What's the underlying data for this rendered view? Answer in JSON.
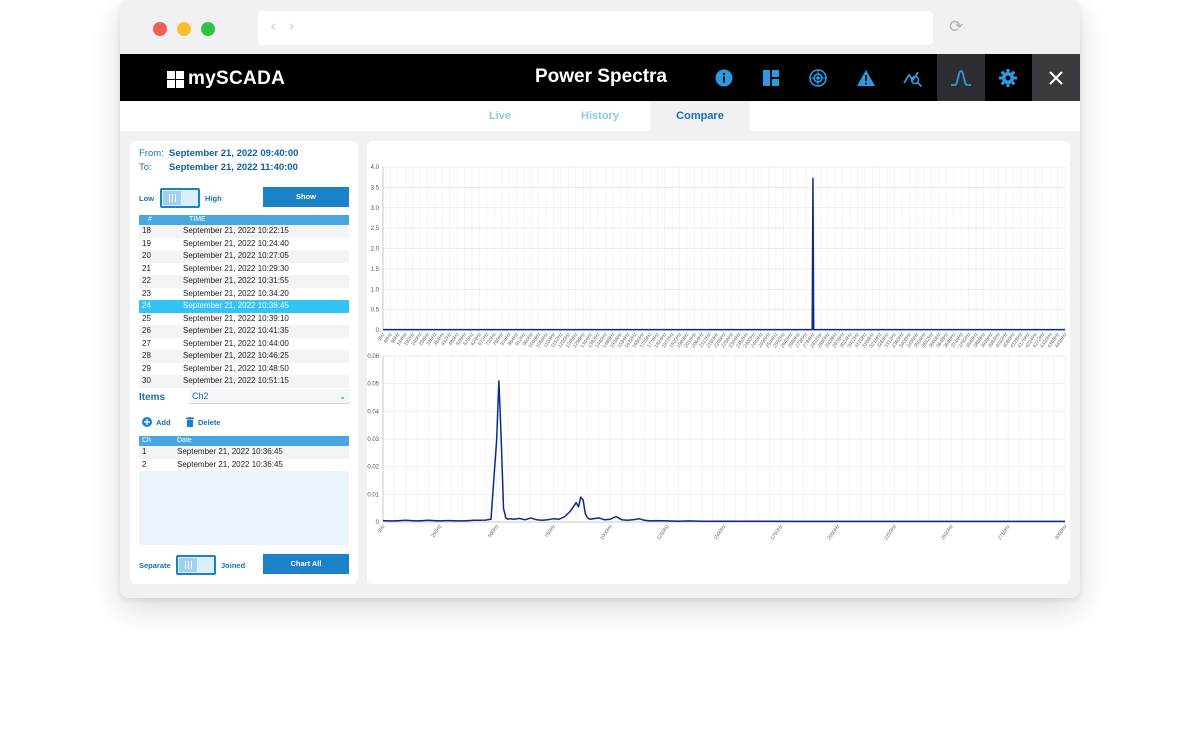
{
  "app": {
    "logo_text": "mySCADA",
    "title": "Power Spectra",
    "header_icons": [
      "info-icon",
      "dashboard-icon",
      "network-icon",
      "alarm-icon",
      "trend-icon",
      "spectrum-icon",
      "settings-icon",
      "close-icon"
    ]
  },
  "tabs": [
    {
      "label": "Live",
      "active": false
    },
    {
      "label": "History",
      "active": false
    },
    {
      "label": "Compare",
      "active": true
    }
  ],
  "range": {
    "from_label": "From:",
    "from_value": "September 21, 2022 09:40:00",
    "to_label": "To:",
    "to_value": "September 21, 2022 11:40:00"
  },
  "quality": {
    "low_label": "Low",
    "high_label": "High",
    "show_label": "Show"
  },
  "time_table": {
    "headers": [
      "#",
      "TIME"
    ],
    "rows": [
      {
        "n": "18",
        "time": "September 21, 2022 10:22:15"
      },
      {
        "n": "19",
        "time": "September 21, 2022 10:24:40"
      },
      {
        "n": "20",
        "time": "September 21, 2022 10:27:05"
      },
      {
        "n": "21",
        "time": "September 21, 2022 10:29:30"
      },
      {
        "n": "22",
        "time": "September 21, 2022 10:31:55"
      },
      {
        "n": "23",
        "time": "September 21, 2022 10:34:20"
      },
      {
        "n": "24",
        "time": "September 21, 2022 10:36:45",
        "selected": true
      },
      {
        "n": "25",
        "time": "September 21, 2022 10:39:10"
      },
      {
        "n": "26",
        "time": "September 21, 2022 10:41:35"
      },
      {
        "n": "27",
        "time": "September 21, 2022 10:44:00"
      },
      {
        "n": "28",
        "time": "September 21, 2022 10:46:25"
      },
      {
        "n": "29",
        "time": "September 21, 2022 10:48:50"
      },
      {
        "n": "30",
        "time": "September 21, 2022 10:51:15"
      }
    ]
  },
  "items": {
    "label": "Items",
    "selected": "Ch2",
    "add_label": "Add",
    "delete_label": "Delete"
  },
  "items_table": {
    "headers": [
      "Ch",
      "Date"
    ],
    "rows": [
      {
        "ch": "1",
        "date": "September 21, 2022 10:36:45"
      },
      {
        "ch": "2",
        "date": "September 21, 2022 10:36:45"
      }
    ]
  },
  "footer": {
    "separate_label": "Separate",
    "joined_label": "Joined",
    "chart_all_label": "Chart All"
  },
  "colors": {
    "accent": "#1b82c9",
    "selected_row": "#33c3f5",
    "series": "#0b2a8a",
    "header_bg": "#000000"
  },
  "chart_data": [
    {
      "type": "line",
      "ylim": [
        0,
        4.0
      ],
      "yticks": [
        "0",
        "0.5",
        "1.0",
        "1.5",
        "2.0",
        "2.5",
        "3.0",
        "3.5",
        "4.0"
      ],
      "x_start": 0,
      "x_step": 48,
      "x_count": 93,
      "x_unit": "Hz",
      "x_tick_every": 1,
      "grid": true,
      "peaks": [
        {
          "x": 2784,
          "y": 3.72
        }
      ],
      "baseline": 0.01
    },
    {
      "type": "line",
      "ylim": [
        0,
        0.06
      ],
      "yticks": [
        "0",
        "0.01",
        "0.02",
        "0.03",
        "0.04",
        "0.05",
        "0.06"
      ],
      "x_start": 0,
      "x_step": 50,
      "x_count": 61,
      "x_unit": "Hz",
      "x_tick_every": 5,
      "grid": true,
      "series": {
        "x": [
          0,
          25,
          50,
          75,
          100,
          125,
          150,
          175,
          200,
          225,
          250,
          275,
          300,
          325,
          350,
          375,
          400,
          425,
          450,
          475,
          500,
          510,
          520,
          530,
          540,
          550,
          560,
          575,
          600,
          625,
          650,
          675,
          700,
          725,
          750,
          775,
          800,
          825,
          850,
          860,
          870,
          880,
          890,
          900,
          910,
          925,
          950,
          975,
          1000,
          1025,
          1050,
          1075,
          1100,
          1125,
          1150,
          1175,
          1200,
          1250,
          1300,
          1350,
          1400,
          1450,
          1500,
          1600,
          1700,
          1800,
          1900,
          2000,
          2200,
          2400,
          2600,
          2800,
          3000
        ],
        "y": [
          0.0005,
          0.0004,
          0.0004,
          0.0005,
          0.0006,
          0.0005,
          0.0004,
          0.0005,
          0.0006,
          0.0005,
          0.0004,
          0.0005,
          0.0005,
          0.0004,
          0.0004,
          0.0005,
          0.0006,
          0.0006,
          0.0007,
          0.001,
          0.03,
          0.051,
          0.03,
          0.005,
          0.0015,
          0.001,
          0.0012,
          0.001,
          0.0013,
          0.0008,
          0.0015,
          0.0008,
          0.0006,
          0.0008,
          0.0012,
          0.001,
          0.002,
          0.004,
          0.007,
          0.0055,
          0.009,
          0.008,
          0.003,
          0.0015,
          0.001,
          0.0012,
          0.0015,
          0.0008,
          0.001,
          0.002,
          0.0008,
          0.0006,
          0.0008,
          0.0012,
          0.0006,
          0.0004,
          0.0005,
          0.0004,
          0.0003,
          0.0004,
          0.0003,
          0.0003,
          0.0003,
          0.0003,
          0.0003,
          0.0002,
          0.0002,
          0.0002,
          0.0002,
          0.0002,
          0.0002,
          0.0002,
          0.0002
        ]
      }
    }
  ]
}
